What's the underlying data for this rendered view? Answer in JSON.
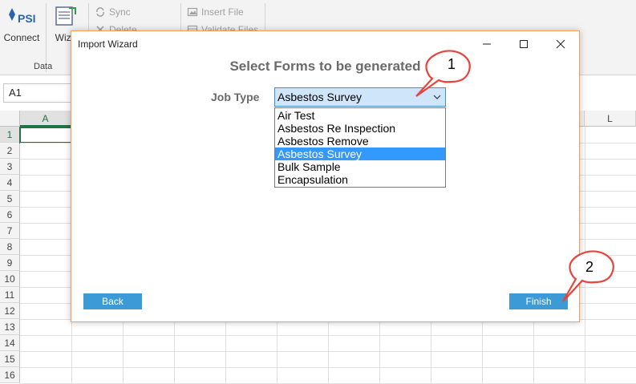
{
  "ribbon": {
    "connect_label": "Connect",
    "wizard_label": "Wiza",
    "sync_label": "Sync",
    "delete_label": "Delete",
    "insert_file_label": "Insert File",
    "validate_files_label": "Validate Files",
    "group_data_label": "Data",
    "logo_text": "PSI"
  },
  "formula_bar": {
    "name_box": "A1"
  },
  "grid": {
    "columns": [
      "A",
      "L"
    ],
    "rows": [
      "1",
      "2",
      "3",
      "4",
      "5",
      "6",
      "7",
      "8",
      "9",
      "10",
      "11",
      "12",
      "13",
      "14",
      "15",
      "16"
    ],
    "selected_cell": "A1"
  },
  "dialog": {
    "title": "Import Wizard",
    "heading": "Select Forms to be generated",
    "job_type_label": "Job Type",
    "job_type_value": "Asbestos Survey",
    "options": [
      "Air Test",
      "Asbestos Re Inspection",
      "Asbestos Remove",
      "Asbestos Survey",
      "Bulk Sample",
      "Encapsulation"
    ],
    "selected_option": "Asbestos Survey",
    "back_label": "Back",
    "finish_label": "Finish"
  },
  "callouts": {
    "first": "1",
    "second": "2"
  },
  "colors": {
    "accent": "#3c9ad6",
    "dropdown_highlight": "#3399ff",
    "callout_stroke": "#e8443c",
    "grid_selection": "#217346"
  }
}
